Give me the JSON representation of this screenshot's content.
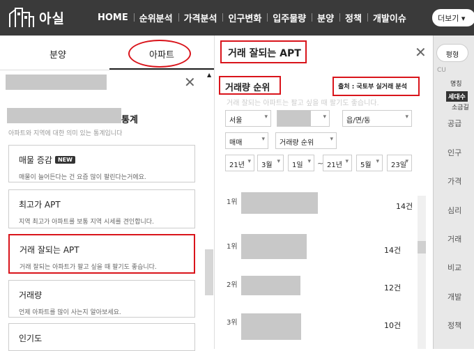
{
  "header": {
    "logo_text": "아실",
    "nav": [
      "HOME",
      "순위분석",
      "가격분석",
      "인구변화",
      "입주물량",
      "분양",
      "정책",
      "개발이슈"
    ],
    "more": "더보기 ▾"
  },
  "left": {
    "tabs": [
      "분양",
      "아파트"
    ],
    "stats_title": "통계",
    "stats_desc": "아파트와 지역에 대한 의미 있는 통계입니다",
    "cards": [
      {
        "title": "매물 증감",
        "badge": "NEW",
        "desc": "매물이 늘어든다는 건 요즘 많이 팔린다는거에요."
      },
      {
        "title": "최고가 APT",
        "desc": "지역 최고가 아파트를 보통 지역 시세를 견인합니다."
      },
      {
        "title": "거래 잘되는 APT",
        "desc": "거래 잘되는 아파트가 팔고 싶을 때 팔기도 좋습니다."
      },
      {
        "title": "거래량",
        "desc": "언제 아파트를 많이 사는지 알아보세요."
      },
      {
        "title": "인기도",
        "desc": ""
      }
    ]
  },
  "middle": {
    "title": "거래 잘되는 APT",
    "section": "거래량 순위",
    "source": "출처 : 국토부 실거래 분석",
    "note": "거래 잘되는 아파트는 팔고 싶을 때 팔기도 좋습니다.",
    "filters": {
      "region": "서울",
      "district": "",
      "dong": "읍/면/동",
      "trade_type": "매매",
      "rank_type": "거래량 순위",
      "from_year": "21년",
      "from_month": "3월",
      "from_day": "1일",
      "to_year": "21년",
      "to_month": "5월",
      "to_day": "23일"
    },
    "ranks": [
      {
        "rank": "1위",
        "count": "14건"
      },
      {
        "rank": "1위",
        "count": "14건"
      },
      {
        "rank": "2위",
        "count": "12건"
      },
      {
        "rank": "3위",
        "count": "10건"
      }
    ]
  },
  "right": {
    "map_type": "평형",
    "items": [
      "공급",
      "인구",
      "가격",
      "심리",
      "거래",
      "비교",
      "개발",
      "정책"
    ],
    "labels": [
      "명칭",
      "세대수",
      "소금길"
    ]
  },
  "colors": {
    "highlight": "#d9141b",
    "topbar": "#3a3a3a"
  }
}
